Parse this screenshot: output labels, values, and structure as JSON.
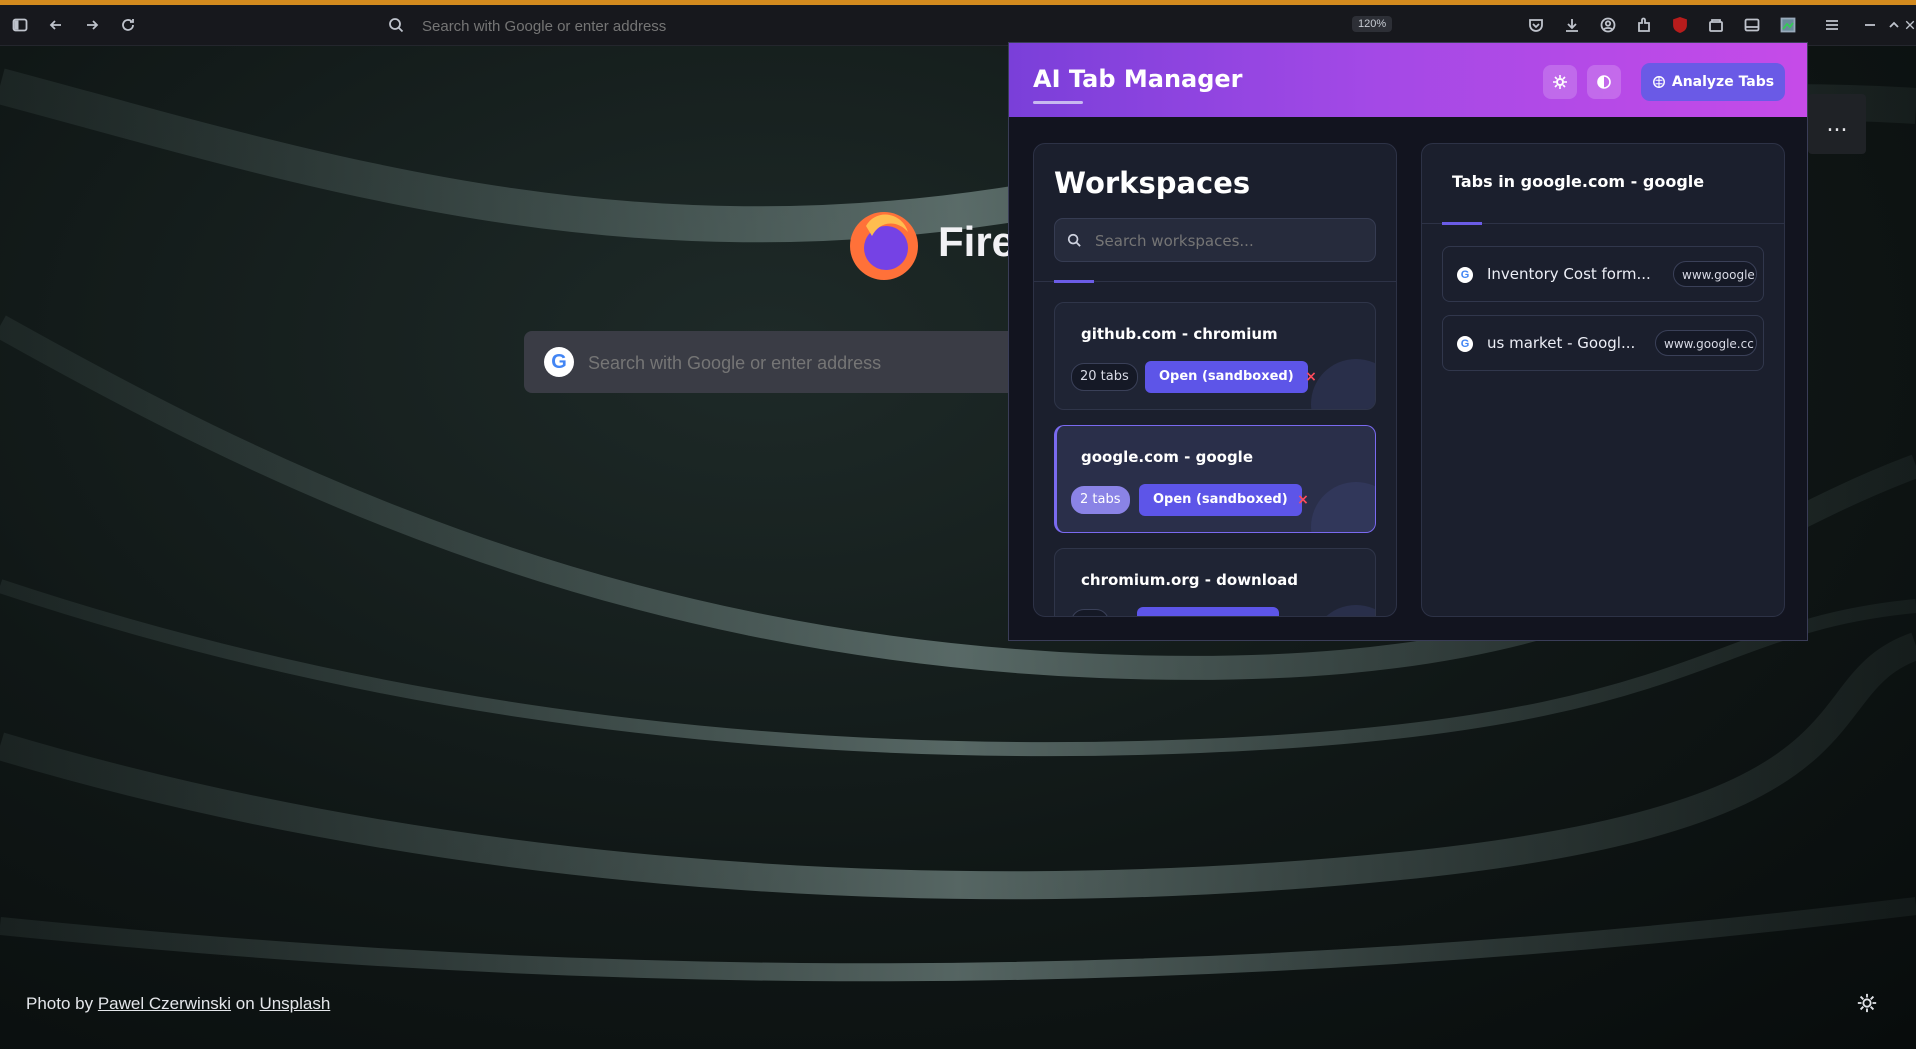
{
  "browser": {
    "url_placeholder": "Search with Google or enter address",
    "zoom": "120%",
    "icons": [
      "sidebar-icon",
      "back-icon",
      "forward-icon",
      "reload-icon",
      "search-icon",
      "pocket-icon",
      "download-icon",
      "account-icon",
      "extensions-icon",
      "ublock-icon",
      "containers-icon",
      "sidebar-toggle-icon",
      "ai-tab-manager-icon",
      "menu-icon",
      "minimize-icon",
      "maximize-icon",
      "close-icon"
    ]
  },
  "newtab": {
    "brand": "Fire",
    "search_placeholder": "Search with Google or enter address",
    "google_glyph": "G",
    "more_label": "...",
    "credit": {
      "prefix": "Photo by",
      "author": "Pawel Czerwinski",
      "middle": "on",
      "site": "Unsplash"
    }
  },
  "popup": {
    "title": "AI Tab Manager",
    "analyze_label": "Analyze Tabs",
    "workspaces": {
      "title": "Workspaces",
      "search_placeholder": "Search workspaces...",
      "items": [
        {
          "name": "github.com - chromium",
          "count": "20 tabs",
          "open_label": "Open (sandboxed)",
          "delete": "×",
          "active": false
        },
        {
          "name": "google.com - google",
          "count": "2 tabs",
          "open_label": "Open (sandboxed)",
          "delete": "×",
          "active": true
        },
        {
          "name": "chromium.org - download",
          "count": "",
          "open_label": "",
          "delete": "",
          "active": false
        }
      ]
    },
    "tabs": {
      "title": "Tabs in google.com - google",
      "items": [
        {
          "title": "Inventory Cost form...",
          "url": "www.google"
        },
        {
          "title": "us market - Googl...",
          "url": "www.google.cc"
        }
      ]
    }
  },
  "colors": {
    "accent": "#5d55e8",
    "header_start": "#7a3fd9",
    "header_end": "#c64be8",
    "delete": "#ff4b5c",
    "top_line": "#d38a1e"
  }
}
